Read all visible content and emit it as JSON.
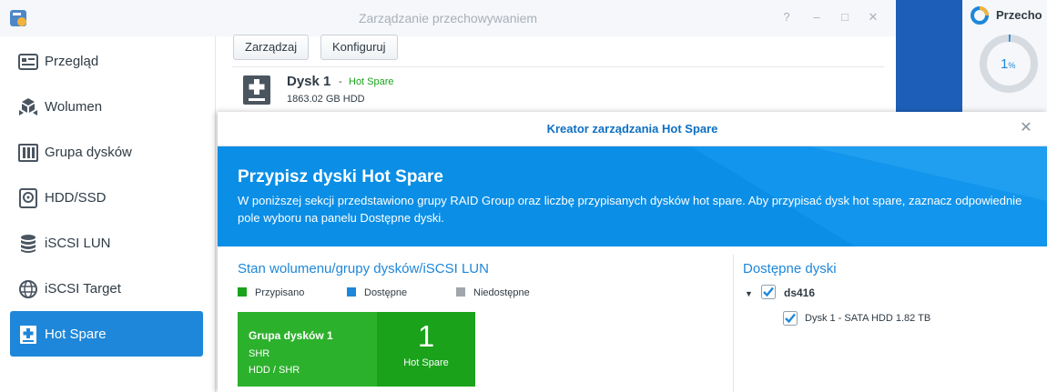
{
  "window": {
    "title": "Zarządzanie przechowywaniem",
    "controls": [
      "?",
      "–",
      "□",
      "✕"
    ]
  },
  "sidebar": {
    "items": [
      {
        "label": "Przegląd",
        "icon": "overview-icon",
        "active": false
      },
      {
        "label": "Wolumen",
        "icon": "volume-icon",
        "active": false
      },
      {
        "label": "Grupa dysków",
        "icon": "disk-group-icon",
        "active": false
      },
      {
        "label": "HDD/SSD",
        "icon": "hdd-icon",
        "active": false
      },
      {
        "label": "iSCSI LUN",
        "icon": "database-icon",
        "active": false
      },
      {
        "label": "iSCSI Target",
        "icon": "globe-icon",
        "active": false
      },
      {
        "label": "Hot Spare",
        "icon": "hot-spare-icon",
        "active": true
      }
    ]
  },
  "toolbar": {
    "manage_label": "Zarządzaj",
    "configure_label": "Konfiguruj"
  },
  "disk": {
    "name": "Dysk 1",
    "separator": "-",
    "status": "Hot Spare",
    "info": "1863.02 GB HDD"
  },
  "right_widget": {
    "title": "Przecho",
    "value": "1",
    "unit": "%",
    "progress": 0.01
  },
  "dialog": {
    "title": "Kreator zarządzania Hot Spare",
    "banner_heading": "Przypisz dyski Hot Spare",
    "banner_text": "W poniższej sekcji przedstawiono grupy RAID Group oraz liczbę przypisanych dysków hot spare. Aby przypisać dysk hot spare, zaznacz odpowiednie pole wyboru na panelu Dostępne dyski.",
    "left_pane": {
      "title": "Stan wolumenu/grupy dysków/iSCSI LUN",
      "legend": [
        {
          "label": "Przypisano",
          "color": "#1aa31a"
        },
        {
          "label": "Dostępne",
          "color": "#1e87d9"
        },
        {
          "label": "Niedostępne",
          "color": "#a0a6ab"
        }
      ],
      "raid_group": {
        "name": "Grupa dysków 1",
        "type": "SHR",
        "disks": "HDD / SHR",
        "count": "1",
        "count_label": "Hot Spare"
      }
    },
    "right_pane": {
      "title": "Dostępne dyski",
      "host": "ds416",
      "disk_row": "Dysk 1 -  SATA HDD 1.82 TB"
    }
  },
  "colors": {
    "accent": "#1e87d9",
    "assigned": "#1aa31a",
    "desktop": "#1d5fb8"
  }
}
